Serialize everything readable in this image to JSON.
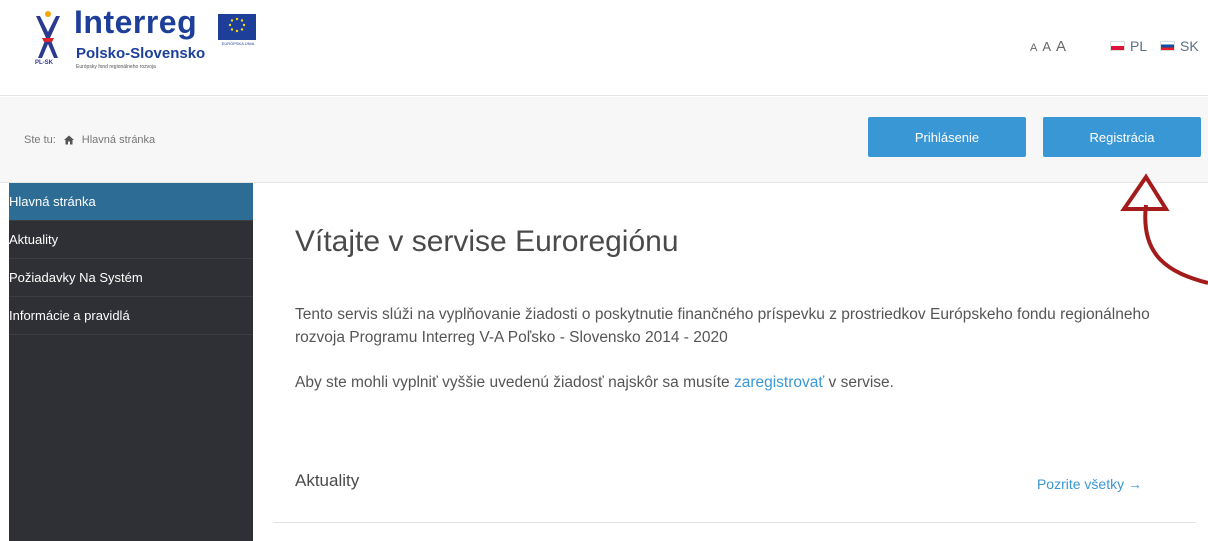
{
  "header": {
    "logo": {
      "name": "Interreg",
      "subtitle": "Polsko-Slovensko",
      "badge": "PL-SK",
      "tagline": "Európsky fond regionálneho rozvoja",
      "eu_label": "EURÓPSKA ÚNIA"
    },
    "font_sizes": [
      "A",
      "A",
      "A"
    ],
    "languages": [
      {
        "code": "PL",
        "flag": "flag-pl-icon"
      },
      {
        "code": "SK",
        "flag": "flag-sk-icon"
      }
    ]
  },
  "breadcrumb": {
    "prefix": "Ste tu:",
    "home_icon": "home-icon",
    "current": "Hlavná stránka"
  },
  "auth": {
    "login_label": "Prihlásenie",
    "register_label": "Registrácia"
  },
  "sidebar": {
    "items": [
      {
        "label": "Hlavná stránka",
        "active": true
      },
      {
        "label": "Aktuality",
        "active": false
      },
      {
        "label": "Požiadavky Na Systém",
        "active": false
      },
      {
        "label": "Informácie a pravidlá",
        "active": false
      }
    ]
  },
  "main": {
    "title": "Vítajte v servise Euroregiónu",
    "intro": "Tento servis slúži na vyplňovanie žiadosti o poskytnutie finančného príspevku z prostriedkov Európskeho fondu regionálneho rozvoja Programu Interreg V-A Poľsko - Slovensko 2014 - 2020",
    "register_prefix": "Aby ste mohli vyplniť vyššie uvedenú žiadosť najskôr sa musíte",
    "register_link": "zaregistrovať",
    "register_suffix": "v servise.",
    "news_title": "Aktuality",
    "see_all": "Pozrite všetky →"
  },
  "colors": {
    "accent": "#3a97d6",
    "sidebar_bg": "#2f3035",
    "sidebar_active": "#2c6c95",
    "annotation": "#a31b1b"
  }
}
